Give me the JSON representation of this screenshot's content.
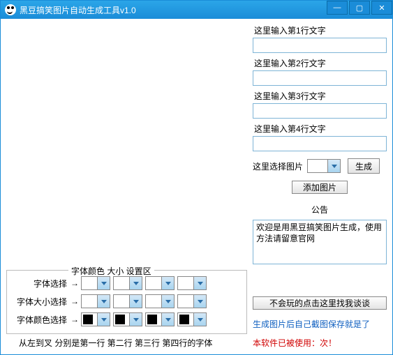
{
  "window": {
    "title": "黑豆搞笑图片自动生成工具v1.0"
  },
  "right": {
    "line1_label": "这里输入第1行文字",
    "line2_label": "这里输入第2行文字",
    "line3_label": "这里输入第3行文字",
    "line4_label": "这里输入第4行文字",
    "line1_value": "",
    "line2_value": "",
    "line3_value": "",
    "line4_value": "",
    "img_select_label": "这里选择图片",
    "generate_btn": "生成",
    "add_img_btn": "添加图片",
    "notice_title": "公告",
    "notice_text": "欢迎是用黑豆搞笑图片生成，使用方法请留意官网",
    "help_link": "不会玩的点击这里找我谈谈",
    "info_blue": "生成图片后自己截图保存就是了",
    "info_red_prefix": "本软件已被使用：",
    "info_red_count": "",
    "info_red_suffix": "次！"
  },
  "settings": {
    "groupbox_title": "字体颜色 大小 设置区",
    "font_label": "字体选择",
    "size_label": "字体大小选择",
    "color_label": "字体颜色选择",
    "arrow": "→",
    "legend": "从左到叉 分别是第一行 第二行 第三行 第四行的字体"
  }
}
